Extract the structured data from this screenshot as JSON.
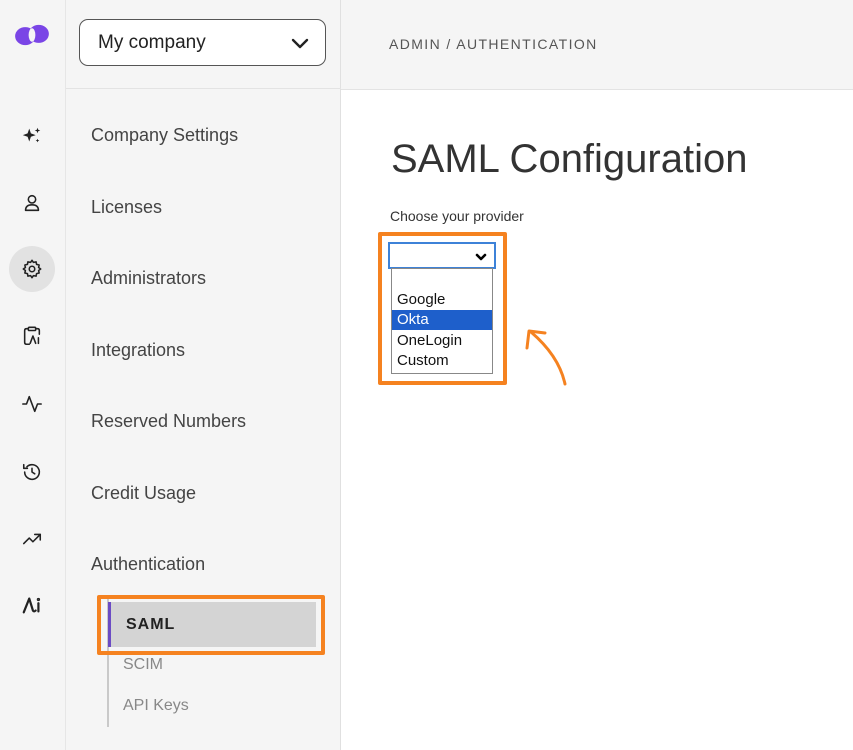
{
  "brand": {
    "accent": "#6b4bc4",
    "highlight": "#f58220",
    "logo_color": "#7a45e6"
  },
  "rail": {
    "icons": [
      "sparkles-icon",
      "user-icon",
      "gear-icon",
      "clipboard-ai-icon",
      "activity-icon",
      "history-icon",
      "trending-up-icon",
      "ai-icon"
    ],
    "active_icon": "gear-icon"
  },
  "company_select": {
    "value": "My company"
  },
  "nav": {
    "items": [
      "Company Settings",
      "Licenses",
      "Administrators",
      "Integrations",
      "Reserved Numbers",
      "Credit Usage",
      "Authentication"
    ],
    "sub_items": [
      "SAML",
      "SCIM",
      "API Keys"
    ],
    "active_sub_item": "SAML"
  },
  "breadcrumb": "ADMIN / AUTHENTICATION",
  "page": {
    "title": "SAML Configuration",
    "provider_label": "Choose your provider",
    "provider_select": {
      "selected_value": "",
      "options": [
        "",
        "Google",
        "Okta",
        "OneLogin",
        "Custom"
      ],
      "highlighted_option": "Okta"
    }
  }
}
